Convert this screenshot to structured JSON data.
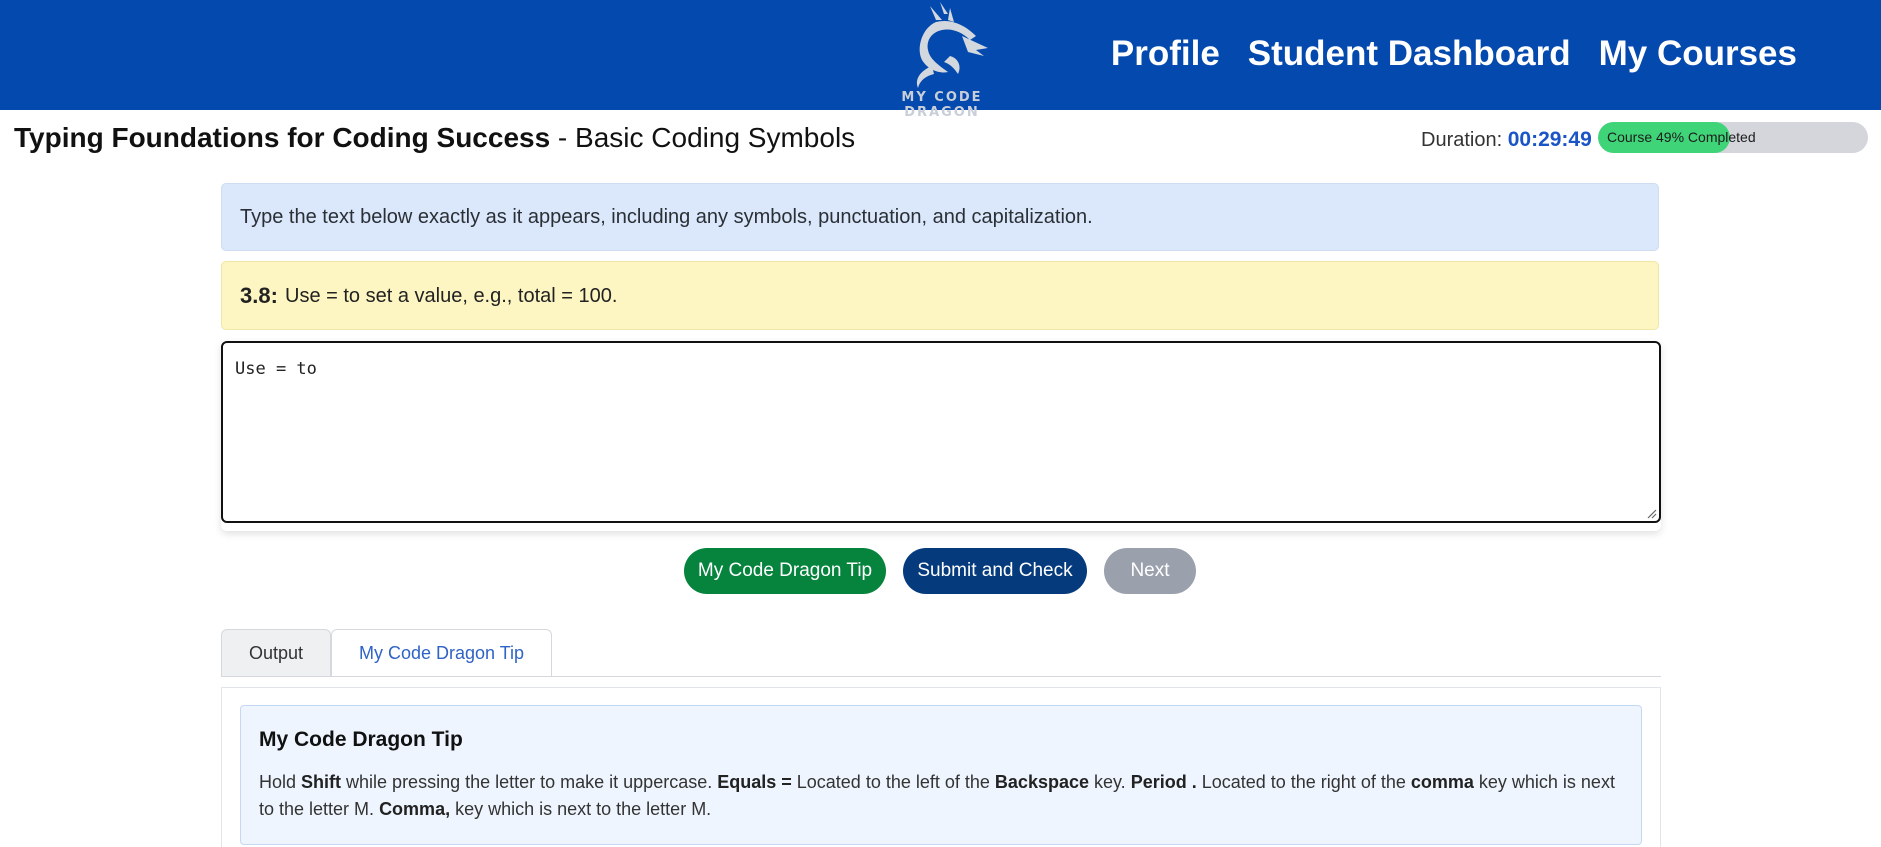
{
  "header": {
    "logo_text": "MY CODE DRAGON",
    "nav": [
      "Profile",
      "Student Dashboard",
      "My Courses"
    ]
  },
  "title": {
    "course": "Typing Foundations for Coding Success",
    "separator": " - ",
    "lesson": "Basic Coding Symbols"
  },
  "duration": {
    "label": "Duration:",
    "time": "00:29:49"
  },
  "progress": {
    "label": "Course 49% Completed",
    "percent": 49
  },
  "instructions": "Type the text below exactly as it appears, including any symbols, punctuation, and capitalization.",
  "prompt": {
    "number": "3.8:",
    "text": "Use = to set a value, e.g., total = 100."
  },
  "editor": {
    "value": "Use = to"
  },
  "buttons": {
    "tip": "My Code Dragon Tip",
    "submit": "Submit and Check",
    "next": "Next"
  },
  "tabs": {
    "output": "Output",
    "tip": "My Code Dragon Tip",
    "active": "tip"
  },
  "tip": {
    "title": "My Code Dragon Tip",
    "segments": [
      {
        "t": "Hold ",
        "b": false
      },
      {
        "t": "Shift",
        "b": true
      },
      {
        "t": " while pressing the letter to make it uppercase.  ",
        "b": false
      },
      {
        "t": "Equals =",
        "b": true
      },
      {
        "t": " Located to the left of the ",
        "b": false
      },
      {
        "t": "Backspace",
        "b": true
      },
      {
        "t": " key. ",
        "b": false
      },
      {
        "t": "Period .",
        "b": true
      },
      {
        "t": " Located to the right of the ",
        "b": false
      },
      {
        "t": "comma",
        "b": true
      },
      {
        "t": " key which is next to the letter M. ",
        "b": false
      },
      {
        "t": "Comma,",
        "b": true
      },
      {
        "t": " key which is next to the letter M.",
        "b": false
      }
    ]
  },
  "colors": {
    "header_bg": "#0449ad",
    "progress_fill": "#3fd478",
    "tip_button": "#06843e",
    "submit_button": "#053b7c",
    "next_button_disabled": "#9ba1ac"
  }
}
